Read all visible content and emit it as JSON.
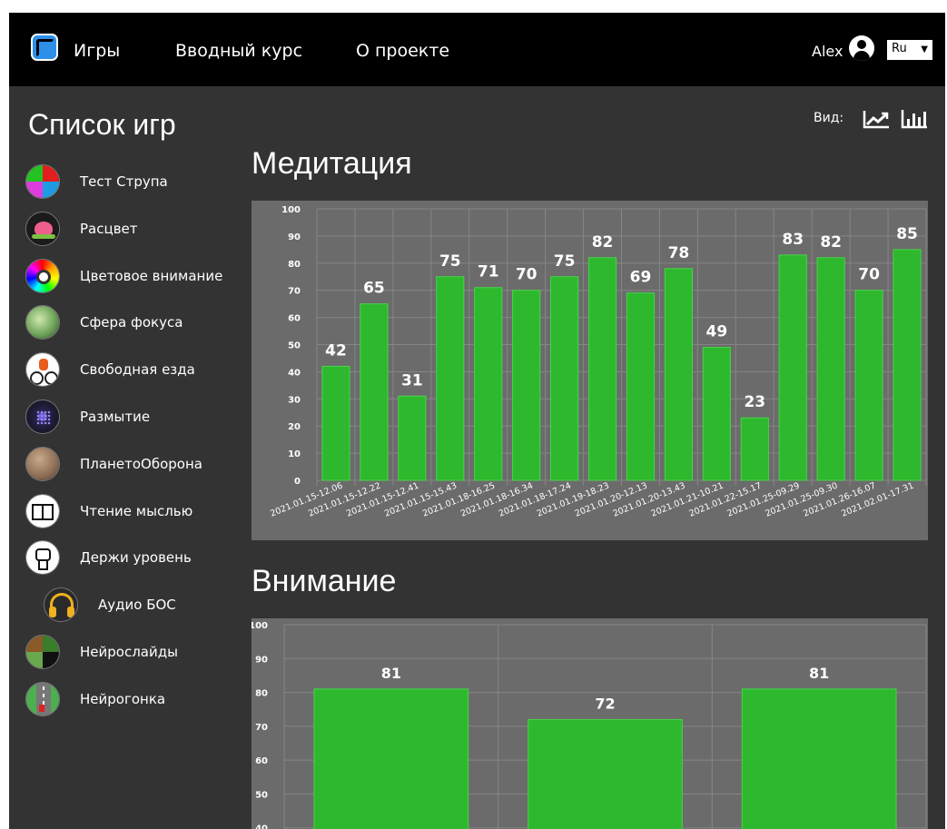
{
  "topbar": {
    "nav": [
      "Игры",
      "Вводный курс",
      "О проекте"
    ],
    "user": "Alex",
    "lang": "Ru"
  },
  "sidebar": {
    "title": "Список игр",
    "games": [
      {
        "label": "Тест Струпа",
        "icon": "stroop-test-icon"
      },
      {
        "label": "Расцвет",
        "icon": "lotus-icon"
      },
      {
        "label": "Цветовое внимание",
        "icon": "color-wheel-icon"
      },
      {
        "label": "Сфера фокуса",
        "icon": "focus-sphere-icon"
      },
      {
        "label": "Свободная езда",
        "icon": "cyclist-icon"
      },
      {
        "label": "Размытие",
        "icon": "blur-dots-icon"
      },
      {
        "label": "ПланетоОборона",
        "icon": "planet-icon"
      },
      {
        "label": "Чтение мыслью",
        "icon": "book-icon"
      },
      {
        "label": "Держи уровень",
        "icon": "fist-icon"
      },
      {
        "label": "Аудио БОС",
        "icon": "headphones-icon"
      },
      {
        "label": "Нейрослайды",
        "icon": "slides-icon"
      },
      {
        "label": "Нейрогонка",
        "icon": "race-road-icon"
      }
    ]
  },
  "view": {
    "label": "Вид:",
    "line_icon": "line-chart-icon",
    "bar_icon": "bar-chart-icon"
  },
  "colors": {
    "bar": "#2db82d",
    "bar_edge": "#49d349",
    "chart_bg": "#6b6b6b",
    "page_bg": "#333333"
  },
  "chart_data": [
    {
      "type": "bar",
      "title": "Медитация",
      "categories": [
        "2021.01.15-12.06",
        "2021.01.15-12.22",
        "2021.01.15-12.41",
        "2021.01.15-15.43",
        "2021.01.18-16.25",
        "2021.01.18-16.34",
        "2021.01.18-17.24",
        "2021.01.19-18.23",
        "2021.01.20-12.13",
        "2021.01.20-13.43",
        "2021.01.21-10.21",
        "2021.01.22-15.17",
        "2021.01.25-09.29",
        "2021.01.25-09.30",
        "2021.01.26-16.07",
        "2021.02.01-17.31"
      ],
      "values": [
        42,
        65,
        31,
        75,
        71,
        70,
        75,
        82,
        69,
        78,
        49,
        23,
        83,
        82,
        70,
        85
      ],
      "ylim": [
        0,
        100
      ],
      "yticks": [
        0,
        10,
        20,
        30,
        40,
        50,
        60,
        70,
        80,
        90,
        100
      ],
      "grid": true
    },
    {
      "type": "bar",
      "title": "Внимание",
      "categories": [
        "",
        "",
        ""
      ],
      "values": [
        81,
        72,
        81
      ],
      "ylim": [
        0,
        100
      ],
      "yticks": [
        40,
        50,
        60,
        70,
        80,
        90,
        100
      ],
      "grid": true
    }
  ]
}
